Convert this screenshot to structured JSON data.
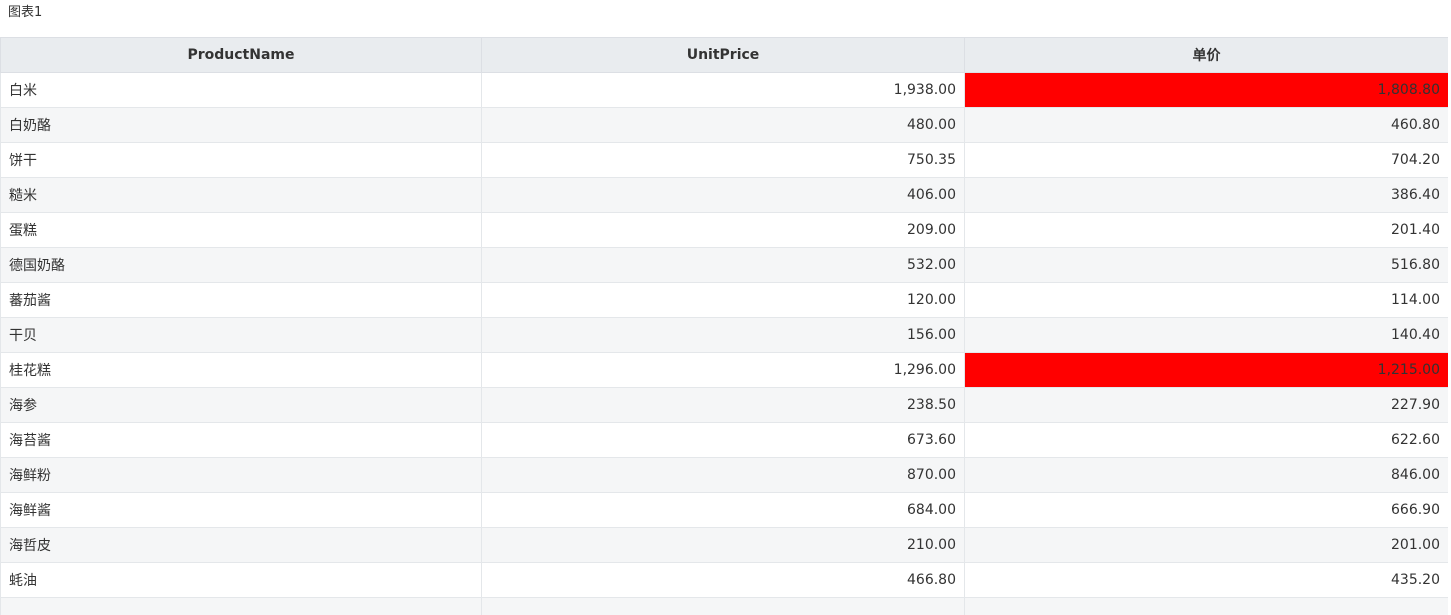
{
  "chart_title": "图表1",
  "table": {
    "headers": [
      "ProductName",
      "UnitPrice",
      "单价"
    ],
    "highlight_color": "#ff0000",
    "rows": [
      {
        "name": "白米",
        "unit_price": "1,938.00",
        "price": "1,808.80",
        "highlight": true
      },
      {
        "name": "白奶酪",
        "unit_price": "480.00",
        "price": "460.80",
        "highlight": false
      },
      {
        "name": "饼干",
        "unit_price": "750.35",
        "price": "704.20",
        "highlight": false
      },
      {
        "name": "糙米",
        "unit_price": "406.00",
        "price": "386.40",
        "highlight": false
      },
      {
        "name": "蛋糕",
        "unit_price": "209.00",
        "price": "201.40",
        "highlight": false
      },
      {
        "name": "德国奶酪",
        "unit_price": "532.00",
        "price": "516.80",
        "highlight": false
      },
      {
        "name": "蕃茄酱",
        "unit_price": "120.00",
        "price": "114.00",
        "highlight": false
      },
      {
        "name": "干贝",
        "unit_price": "156.00",
        "price": "140.40",
        "highlight": false
      },
      {
        "name": "桂花糕",
        "unit_price": "1,296.00",
        "price": "1,215.00",
        "highlight": true
      },
      {
        "name": "海参",
        "unit_price": "238.50",
        "price": "227.90",
        "highlight": false
      },
      {
        "name": "海苔酱",
        "unit_price": "673.60",
        "price": "622.60",
        "highlight": false
      },
      {
        "name": "海鲜粉",
        "unit_price": "870.00",
        "price": "846.00",
        "highlight": false
      },
      {
        "name": "海鲜酱",
        "unit_price": "684.00",
        "price": "666.90",
        "highlight": false
      },
      {
        "name": "海哲皮",
        "unit_price": "210.00",
        "price": "201.00",
        "highlight": false
      },
      {
        "name": "蚝油",
        "unit_price": "466.80",
        "price": "435.20",
        "highlight": false
      },
      {
        "name": "",
        "unit_price": "",
        "price": "",
        "highlight": false
      }
    ]
  }
}
